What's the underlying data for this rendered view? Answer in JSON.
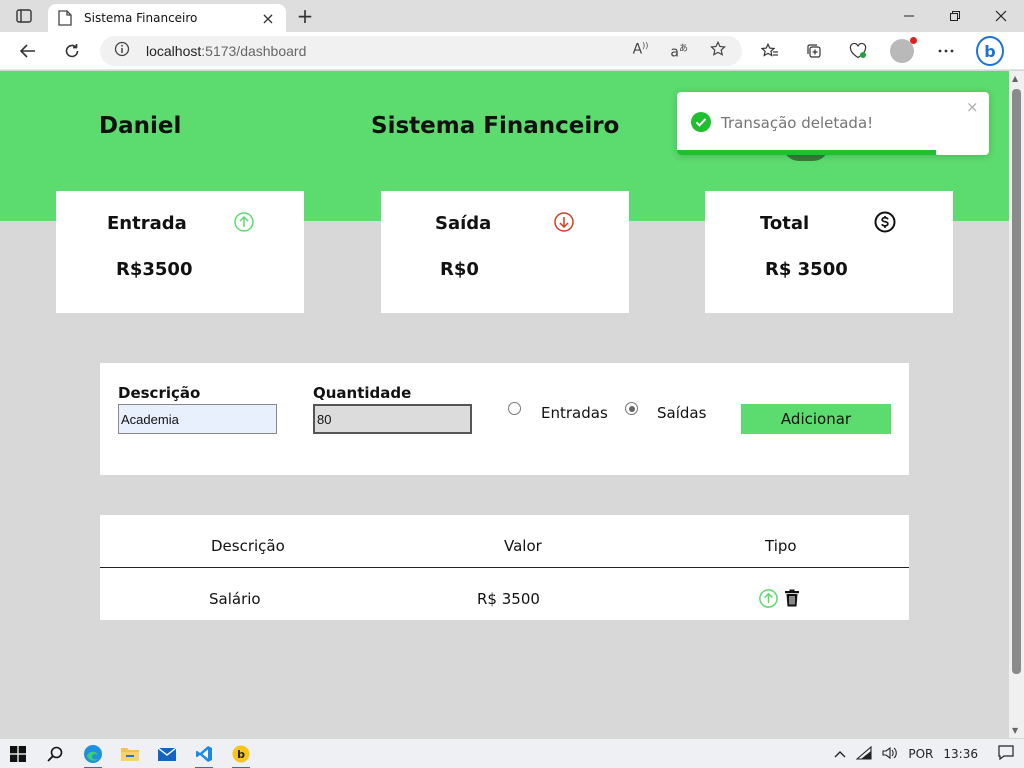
{
  "browser": {
    "tab_title": "Sistema Financeiro",
    "url_host": "localhost",
    "url_path": ":5173/dashboard",
    "new_tab": "+",
    "tab_close": "×"
  },
  "header": {
    "user_name": "Daniel",
    "app_title": "Sistema Financeiro"
  },
  "cards": {
    "entrada": {
      "title": "Entrada",
      "value": "R$3500",
      "icon": "arrow-up-circle-icon",
      "color": "#5cdb6e"
    },
    "saida": {
      "title": "Saída",
      "value": "R$0",
      "icon": "arrow-down-circle-icon",
      "color": "#d63b1f"
    },
    "total": {
      "title": "Total",
      "value": "R$ 3500",
      "icon": "dollar-circle-icon",
      "color": "#111111"
    }
  },
  "form": {
    "descricao_label": "Descrição",
    "descricao_value": "Academia",
    "quantidade_label": "Quantidade",
    "quantidade_value": "80",
    "radio_entradas": "Entradas",
    "radio_saidas": "Saídas",
    "selected": "Saídas",
    "add_button": "Adicionar"
  },
  "table": {
    "columns": [
      "Descrição",
      "Valor",
      "Tipo"
    ],
    "rows": [
      {
        "descricao": "Salário",
        "valor": "R$ 3500",
        "tipo": "entrada"
      }
    ]
  },
  "toast": {
    "message": "Transação deletada!",
    "close": "×",
    "progress": 0.83,
    "color": "#1fbf2e"
  },
  "taskbar": {
    "language": "POR",
    "time": "13:36"
  },
  "colors": {
    "accent": "#5cdb6e",
    "background": "#d8d8d8"
  }
}
